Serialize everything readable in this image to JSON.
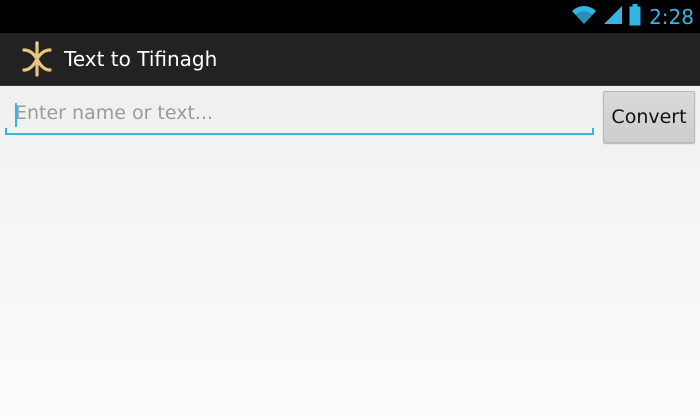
{
  "status_bar": {
    "time": "2:28",
    "icons": [
      "wifi-icon",
      "signal-icon",
      "battery-icon"
    ],
    "accent_color": "#33b5e5"
  },
  "action_bar": {
    "app_icon": "tifinagh-yaz-icon",
    "title": "Text to Tifinagh"
  },
  "main": {
    "input": {
      "value": "",
      "placeholder": "Enter name or text..."
    },
    "convert_button": {
      "label": "Convert"
    }
  }
}
